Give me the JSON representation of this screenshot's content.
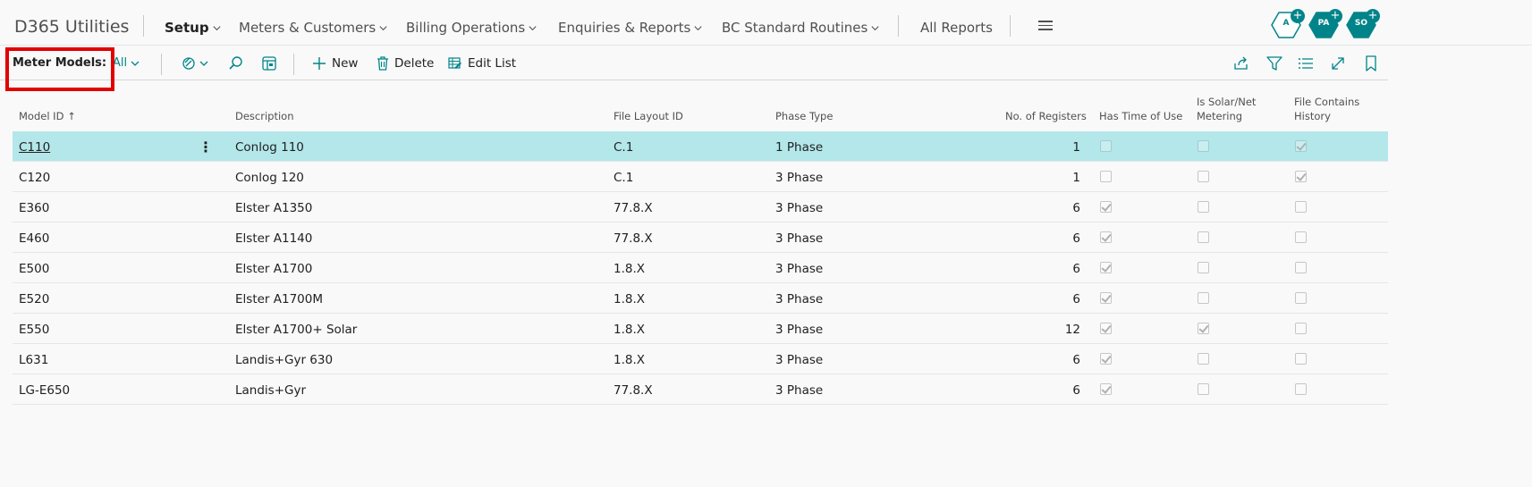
{
  "nav": {
    "app_title": "D365 Utilities",
    "items": [
      {
        "label": "Setup",
        "active": true
      },
      {
        "label": "Meters & Customers"
      },
      {
        "label": "Billing Operations"
      },
      {
        "label": "Enquiries & Reports"
      },
      {
        "label": "BC Standard Routines"
      }
    ],
    "all_reports": "All Reports",
    "avatars": [
      "A",
      "PA",
      "SO"
    ]
  },
  "actionbar": {
    "caption": "Meter Models:",
    "view_filter": "All",
    "new_label": "New",
    "delete_label": "Delete",
    "edit_list_label": "Edit List"
  },
  "grid": {
    "headers": {
      "model_id": "Model ID",
      "description": "Description",
      "file_layout_id": "File Layout ID",
      "phase_type": "Phase Type",
      "no_registers": "No. of Registers",
      "has_time_of_use": "Has Time of Use",
      "solar_line1": "Is Solar/Net",
      "solar_line2": "Metering",
      "history_line1": "File Contains",
      "history_line2": "History"
    },
    "sort_indicator": "↑",
    "rows": [
      {
        "model_id": "C110",
        "description": "Conlog 110",
        "file_layout_id": "C.1",
        "phase_type": "1 Phase",
        "registers": "1",
        "tou": false,
        "solar": false,
        "history": true
      },
      {
        "model_id": "C120",
        "description": "Conlog 120",
        "file_layout_id": "C.1",
        "phase_type": "3 Phase",
        "registers": "1",
        "tou": false,
        "solar": false,
        "history": true
      },
      {
        "model_id": "E360",
        "description": "Elster A1350",
        "file_layout_id": "77.8.X",
        "phase_type": "3 Phase",
        "registers": "6",
        "tou": true,
        "solar": false,
        "history": false
      },
      {
        "model_id": "E460",
        "description": "Elster A1140",
        "file_layout_id": "77.8.X",
        "phase_type": "3 Phase",
        "registers": "6",
        "tou": true,
        "solar": false,
        "history": false
      },
      {
        "model_id": "E500",
        "description": "Elster A1700",
        "file_layout_id": "1.8.X",
        "phase_type": "3 Phase",
        "registers": "6",
        "tou": true,
        "solar": false,
        "history": false
      },
      {
        "model_id": "E520",
        "description": "Elster A1700M",
        "file_layout_id": "1.8.X",
        "phase_type": "3 Phase",
        "registers": "6",
        "tou": true,
        "solar": false,
        "history": false
      },
      {
        "model_id": "E550",
        "description": "Elster A1700+ Solar",
        "file_layout_id": "1.8.X",
        "phase_type": "3 Phase",
        "registers": "12",
        "tou": true,
        "solar": true,
        "history": false
      },
      {
        "model_id": "L631",
        "description": "Landis+Gyr 630",
        "file_layout_id": "1.8.X",
        "phase_type": "3 Phase",
        "registers": "6",
        "tou": true,
        "solar": false,
        "history": false
      },
      {
        "model_id": "LG-E650",
        "description": "Landis+Gyr",
        "file_layout_id": "77.8.X",
        "phase_type": "3 Phase",
        "registers": "6",
        "tou": true,
        "solar": false,
        "history": false
      }
    ]
  },
  "colors": {
    "accent": "#008489",
    "selected_row": "#b3e7ea",
    "highlight": "#e10000"
  }
}
